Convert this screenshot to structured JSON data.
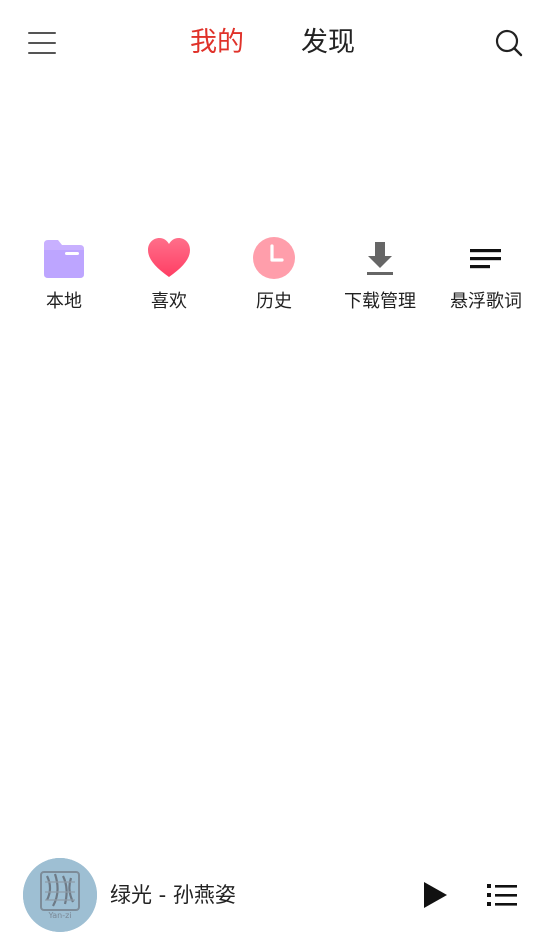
{
  "header": {
    "tabs": [
      {
        "label": "我的",
        "active": true,
        "color": "#e0322a"
      },
      {
        "label": "发现",
        "active": false
      }
    ],
    "icons": {
      "menu": "menu-icon",
      "search": "search-icon"
    }
  },
  "quick_actions": [
    {
      "label": "本地",
      "icon": "folder-icon",
      "color": "#c4a8ff"
    },
    {
      "label": "喜欢",
      "icon": "heart-icon",
      "color": "#ff5a78"
    },
    {
      "label": "历史",
      "icon": "clock-icon",
      "color": "#ff9aa8"
    },
    {
      "label": "下载管理",
      "icon": "download-icon",
      "color": "#666666"
    },
    {
      "label": "悬浮歌词",
      "icon": "lyrics-icon",
      "color": "#111111"
    }
  ],
  "player": {
    "song_title": "绿光 - 孙燕姿",
    "cover_text": "Yan-zi",
    "icons": {
      "play": "play-icon",
      "playlist": "playlist-icon"
    }
  }
}
